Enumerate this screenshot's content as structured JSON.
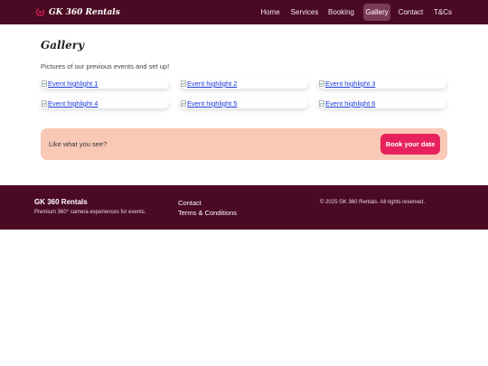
{
  "brand": {
    "name": "GK 360 Rentals",
    "icon": "camera-rotate-icon"
  },
  "nav": {
    "items": [
      {
        "label": "Home",
        "active": false
      },
      {
        "label": "Services",
        "active": false
      },
      {
        "label": "Booking",
        "active": false
      },
      {
        "label": "Gallery",
        "active": true
      },
      {
        "label": "Contact",
        "active": false
      },
      {
        "label": "T&Cs",
        "active": false
      }
    ]
  },
  "gallery": {
    "title": "Gallery",
    "intro": "Pictures of our previous events and set up!",
    "images": [
      {
        "alt": "Event highlight 1"
      },
      {
        "alt": "Event highlight 2"
      },
      {
        "alt": "Event highlight 3"
      },
      {
        "alt": "Event highlight 4"
      },
      {
        "alt": "Event highlight 5"
      },
      {
        "alt": "Event highlight 6"
      }
    ]
  },
  "cta": {
    "text": "Like what you see?",
    "button": "Book your date"
  },
  "footer": {
    "brand": "GK 360 Rentals",
    "tagline": "Premium 360° camera experiences for events.",
    "links": [
      "Contact",
      "Terms & Conditions"
    ],
    "copyright": "© 2025 GK 360 Rentals. All rights reserved."
  },
  "colors": {
    "header_bg": "#4a0a23",
    "footer_bg": "#4a0a23",
    "nav_active_bg": "#7b3a55",
    "cta_bg": "#f9c9b6",
    "cta_button": "#e6215c",
    "link": "#1a3ad8"
  }
}
